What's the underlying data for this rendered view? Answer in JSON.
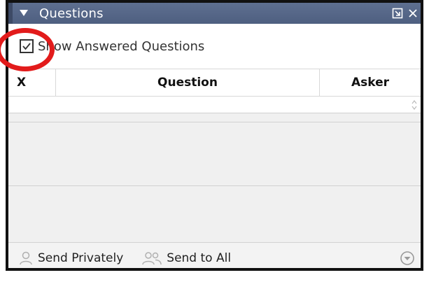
{
  "panel": {
    "title": "Questions",
    "show_answered_label": "Show Answered Questions",
    "show_answered_checked": true
  },
  "table": {
    "columns": [
      "X",
      "Question",
      "Asker"
    ]
  },
  "footer": {
    "send_privately": "Send Privately",
    "send_to_all": "Send to All"
  },
  "colors": {
    "titlebar": "#56678a",
    "highlight": "#e21b1b",
    "background": "#f0f0f0"
  },
  "icons": {
    "collapse": "triangle-down-icon",
    "popout": "popout-icon",
    "close": "close-icon",
    "checkbox": "checkmark-icon",
    "send_private": "person-icon",
    "send_all": "people-icon",
    "menu": "chevron-circle-icon"
  }
}
